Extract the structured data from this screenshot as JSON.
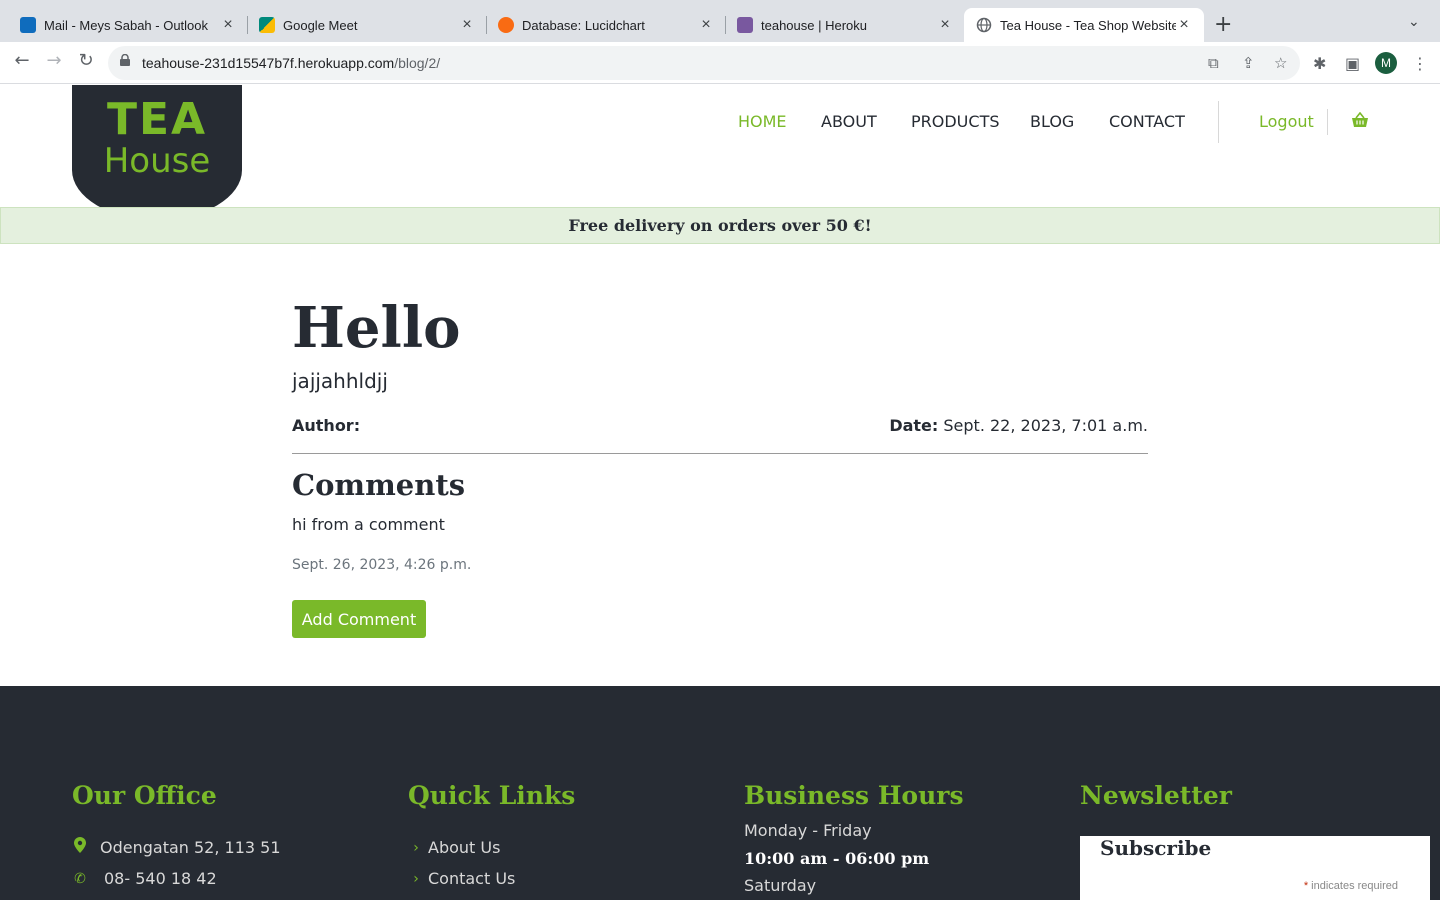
{
  "browser": {
    "tabs": [
      {
        "title": "Mail - Meys Sabah - Outlook",
        "favicon": "outlook-icon",
        "color": "#0f6cbd"
      },
      {
        "title": "Google Meet",
        "favicon": "google-meet-icon",
        "color": "#00897b"
      },
      {
        "title": "Database: Lucidchart",
        "favicon": "lucidchart-icon",
        "color": "#f96b13"
      },
      {
        "title": "teahouse | Heroku",
        "favicon": "heroku-icon",
        "color": "#79589f"
      },
      {
        "title": "Tea House - Tea Shop Website",
        "favicon": "globe-icon",
        "color": "#5f6368"
      }
    ],
    "url_host": "teahouse-231d15547b7f.herokuapp.com",
    "url_path": "/blog/2/",
    "profile_initial": "M"
  },
  "site": {
    "logo_line1": "TEA",
    "logo_line2": "House",
    "nav": {
      "home": "HOME",
      "about": "ABOUT",
      "products": "PRODUCTS",
      "blog": "BLOG",
      "contact": "CONTACT",
      "logout": "Logout"
    },
    "banner": "Free delivery on orders over 50 €!",
    "accent_color": "#7ab929",
    "dark_color": "#262b33"
  },
  "post": {
    "title": "Hello",
    "body": "jajjahhldjj",
    "author_label": "Author:",
    "date_label": "Date:",
    "date_value": "Sept. 22, 2023, 7:01 a.m."
  },
  "comments": {
    "heading": "Comments",
    "items": [
      {
        "text": "hi from a comment",
        "date": "Sept. 26, 2023, 4:26 p.m."
      }
    ],
    "add_button": "Add Comment"
  },
  "footer": {
    "office": {
      "heading": "Our Office",
      "address": "Odengatan 52, 113 51",
      "phone": "08- 540 18 42"
    },
    "links": {
      "heading": "Quick Links",
      "items": [
        "About Us",
        "Contact Us"
      ]
    },
    "hours": {
      "heading": "Business Hours",
      "day1": "Monday - Friday",
      "time1": "10:00 am - 06:00 pm",
      "day2": "Saturday"
    },
    "newsletter": {
      "heading": "Newsletter",
      "subscribe": "Subscribe",
      "required_note": "indicates required"
    }
  }
}
